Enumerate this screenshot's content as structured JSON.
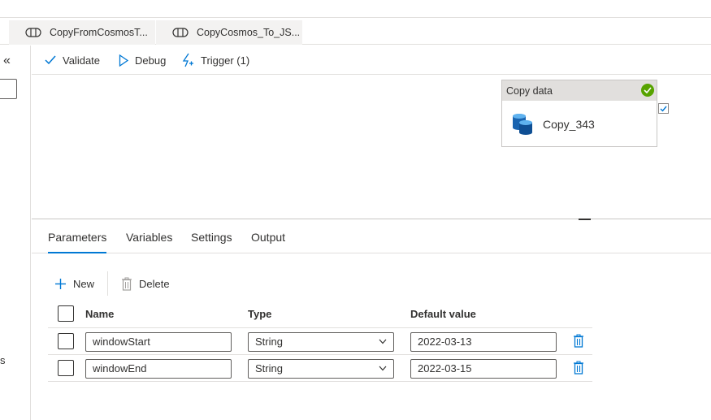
{
  "tabs": [
    {
      "label": "CopyFromCosmosT...",
      "icon": "pipeline-icon"
    },
    {
      "label": "CopyCosmos_To_JS...",
      "icon": "pipeline-icon"
    }
  ],
  "left_rail": {
    "collapse_label": "«",
    "clipped_text": "s"
  },
  "toolbar": {
    "validate_label": "Validate",
    "debug_label": "Debug",
    "trigger_label": "Trigger (1)"
  },
  "activity": {
    "type_label": "Copy data",
    "name": "Copy_343",
    "status": "succeeded"
  },
  "panel": {
    "tabs": [
      "Parameters",
      "Variables",
      "Settings",
      "Output"
    ],
    "active_tab": "Parameters",
    "commands": {
      "new_label": "New",
      "delete_label": "Delete"
    },
    "columns": {
      "name": "Name",
      "type": "Type",
      "default": "Default value"
    },
    "rows": [
      {
        "name": "windowStart",
        "type": "String",
        "default": "2022-03-13"
      },
      {
        "name": "windowEnd",
        "type": "String",
        "default": "2022-03-15"
      }
    ]
  },
  "colors": {
    "accent": "#0078d4",
    "success": "#57a300",
    "delete_icon": "#0078d4"
  }
}
